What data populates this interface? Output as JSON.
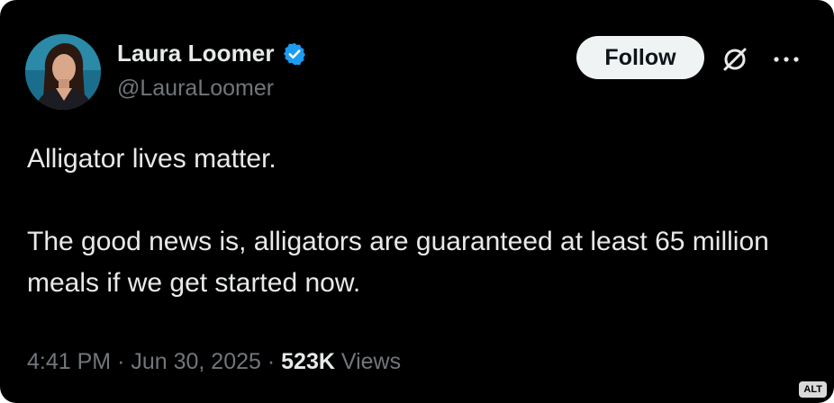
{
  "author": {
    "display_name": "Laura Loomer",
    "handle": "@LauraLoomer",
    "verified": true,
    "avatar_icon": "profile-photo"
  },
  "actions": {
    "follow_label": "Follow",
    "grok_icon": "grok-icon",
    "more_icon": "more-options-icon"
  },
  "tweet": {
    "line1": "Alligator lives matter.",
    "line2": "The good news is, alligators are guaranteed at least 65 million meals if we get started now."
  },
  "meta": {
    "time": "4:41 PM",
    "separator": "·",
    "date": "Jun 30, 2025",
    "views_count": "523K",
    "views_label": "Views"
  },
  "alt_badge": "ALT",
  "colors": {
    "background": "#000000",
    "text_primary": "#e7e9ea",
    "text_secondary": "#71767b",
    "verified_blue": "#1d9bf0",
    "follow_bg": "#eff3f4"
  }
}
